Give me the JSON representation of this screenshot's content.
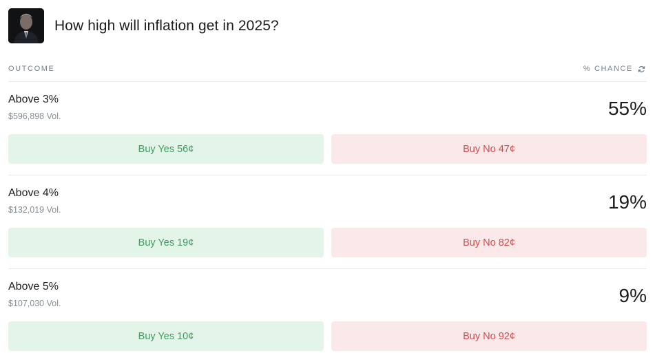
{
  "market": {
    "title": "How high will inflation get in 2025?",
    "avatar_icon": "person-portrait-icon"
  },
  "table_header": {
    "outcome_label": "OUTCOME",
    "chance_label": "% CHANCE",
    "refresh_icon": "refresh-icon"
  },
  "outcomes": [
    {
      "label": "Above 3%",
      "volume": "$596,898 Vol.",
      "chance": "55%",
      "buy_yes": "Buy Yes 56¢",
      "buy_no": "Buy No 47¢"
    },
    {
      "label": "Above 4%",
      "volume": "$132,019 Vol.",
      "chance": "19%",
      "buy_yes": "Buy Yes 19¢",
      "buy_no": "Buy No 82¢"
    },
    {
      "label": "Above 5%",
      "volume": "$107,030 Vol.",
      "chance": "9%",
      "buy_yes": "Buy Yes 10¢",
      "buy_no": "Buy No 92¢"
    }
  ],
  "colors": {
    "yes_bg": "#e2f5e8",
    "yes_text": "#3e9a5e",
    "no_bg": "#fbe9e9",
    "no_text": "#d24b4b"
  }
}
